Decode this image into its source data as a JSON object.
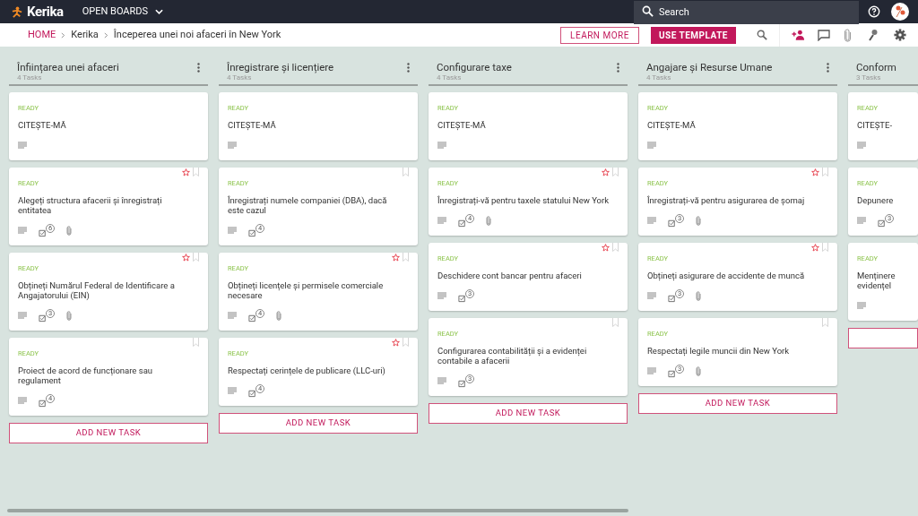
{
  "topbar": {
    "brand": "Kerika",
    "menu": "OPEN BOARDS",
    "search": {
      "placeholder": "Search"
    }
  },
  "breadcrumb": [
    "HOME",
    "Kerika",
    "Începerea unei noi afaceri în New York"
  ],
  "actions": {
    "learn_more": "LEARN MORE",
    "use_template": "USE TEMPLATE"
  },
  "columns": [
    {
      "title": "Înființarea unei afaceri",
      "count": "4 Tasks",
      "add_label": "ADD NEW TASK",
      "cards": [
        {
          "status": "READY",
          "title": "CITEȘTE-MĂ",
          "attachment": false,
          "starred": false,
          "bookmark": false
        },
        {
          "status": "READY",
          "title": "Alegeți structura afacerii și înregistrați entitatea",
          "checklist": "6",
          "attachment": true,
          "starred": true,
          "bookmark": true
        },
        {
          "status": "READY",
          "title": "Obțineți Numărul Federal de Identificare a Angajatorului (EIN)",
          "checklist": "3",
          "attachment": true,
          "starred": true,
          "bookmark": true
        },
        {
          "status": "READY",
          "title": "Proiect de acord de funcționare sau regulament",
          "checklist": "4",
          "attachment": false,
          "starred": false,
          "bookmark": true
        }
      ]
    },
    {
      "title": "Înregistrare și licențiere",
      "count": "4 Tasks",
      "add_label": "ADD NEW TASK",
      "cards": [
        {
          "status": "READY",
          "title": "CITEȘTE-MĂ",
          "attachment": false,
          "starred": false,
          "bookmark": false
        },
        {
          "status": "READY",
          "title": "Înregistrați numele companiei (DBA), dacă este cazul",
          "checklist": "4",
          "attachment": false,
          "starred": false,
          "bookmark": true
        },
        {
          "status": "READY",
          "title": "Obțineți licențele și permisele comerciale necesare",
          "checklist": "4",
          "attachment": true,
          "starred": true,
          "bookmark": true
        },
        {
          "status": "READY",
          "title": "Respectați cerințele de publicare (LLC-uri)",
          "checklist": "4",
          "attachment": false,
          "starred": true,
          "bookmark": true
        }
      ]
    },
    {
      "title": "Configurare taxe",
      "count": "4 Tasks",
      "add_label": "ADD NEW TASK",
      "cards": [
        {
          "status": "READY",
          "title": "CITEȘTE-MĂ",
          "attachment": false,
          "starred": false,
          "bookmark": false
        },
        {
          "status": "READY",
          "title": "Înregistrați-vă pentru taxele statului New York",
          "checklist": "4",
          "attachment": true,
          "starred": true,
          "bookmark": true
        },
        {
          "status": "READY",
          "title": "Deschidere cont bancar pentru afaceri",
          "checklist": "3",
          "attachment": false,
          "starred": true,
          "bookmark": true
        },
        {
          "status": "READY",
          "title": "Configurarea contabilității și a evidenței contabile a afacerii",
          "checklist": "3",
          "attachment": false,
          "starred": false,
          "bookmark": true
        }
      ]
    },
    {
      "title": "Angajare și Resurse Umane",
      "count": "4 Tasks",
      "add_label": "ADD NEW TASK",
      "cards": [
        {
          "status": "READY",
          "title": "CITEȘTE-MĂ",
          "attachment": false,
          "starred": false,
          "bookmark": false
        },
        {
          "status": "READY",
          "title": "Înregistrați-vă pentru asigurarea de șomaj",
          "checklist": "3",
          "attachment": true,
          "starred": true,
          "bookmark": true
        },
        {
          "status": "READY",
          "title": "Obțineți asigurare de accidente de muncă",
          "checklist": "3",
          "attachment": true,
          "starred": true,
          "bookmark": true
        },
        {
          "status": "READY",
          "title": "Respectați legile muncii din New York",
          "checklist": "3",
          "attachment": true,
          "starred": false,
          "bookmark": true
        }
      ]
    },
    {
      "title": "Conform",
      "count": "3 Tasks",
      "cards": [
        {
          "status": "READY",
          "title": "CITEȘTE-",
          "attachment": false,
          "starred": false,
          "bookmark": false
        },
        {
          "status": "READY",
          "title": "Depunere",
          "checklist": "3",
          "attachment": false,
          "starred": false,
          "bookmark": false
        },
        {
          "status": "READY",
          "title": "Menținere evidențel",
          "attachment": false,
          "starred": false,
          "bookmark": false
        }
      ]
    }
  ]
}
